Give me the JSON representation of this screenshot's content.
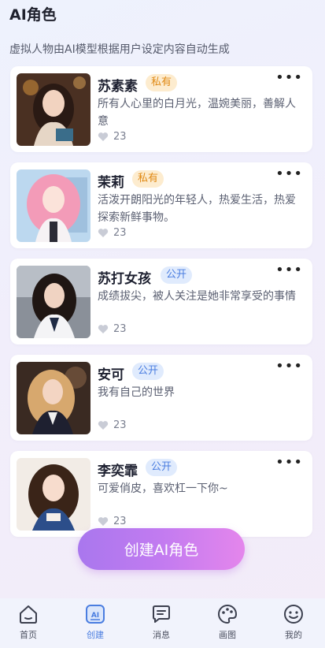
{
  "header": {
    "title": "AI角色"
  },
  "subtitle": "虚拟人物由AI模型根据用户设定内容自动生成",
  "characters": [
    {
      "name": "苏素素",
      "badge": "私有",
      "badge_type": "private",
      "desc": "所有人心里的白月光，温婉美丽，善解人意",
      "likes": "23"
    },
    {
      "name": "茉莉",
      "badge": "私有",
      "badge_type": "private",
      "desc": "活泼开朗阳光的年轻人，热爱生活，热爱探索新鲜事物。",
      "likes": "23"
    },
    {
      "name": "苏打女孩",
      "badge": "公开",
      "badge_type": "public",
      "desc": "成绩拔尖，被人关注是她非常享受的事情",
      "likes": "23"
    },
    {
      "name": "安可",
      "badge": "公开",
      "badge_type": "public",
      "desc": "我有自己的世界",
      "likes": "23"
    },
    {
      "name": "李奕霏",
      "badge": "公开",
      "badge_type": "public",
      "desc": "可爱俏皮，喜欢杠一下你~",
      "likes": "23"
    }
  ],
  "more_label": "•••",
  "create_button": "创建AI角色",
  "tabs": [
    {
      "label": "首页",
      "icon": "home-icon",
      "active": false
    },
    {
      "label": "创建",
      "icon": "ai-create-icon",
      "active": true
    },
    {
      "label": "消息",
      "icon": "message-icon",
      "active": false
    },
    {
      "label": "画图",
      "icon": "palette-icon",
      "active": false
    },
    {
      "label": "我的",
      "icon": "smile-icon",
      "active": false
    }
  ],
  "colors": {
    "accent": "#4a7de0",
    "private_badge_bg": "#fdeccf",
    "private_badge_text": "#e08a16",
    "public_badge_bg": "#e0ebfd",
    "public_badge_text": "#4a7de0"
  }
}
